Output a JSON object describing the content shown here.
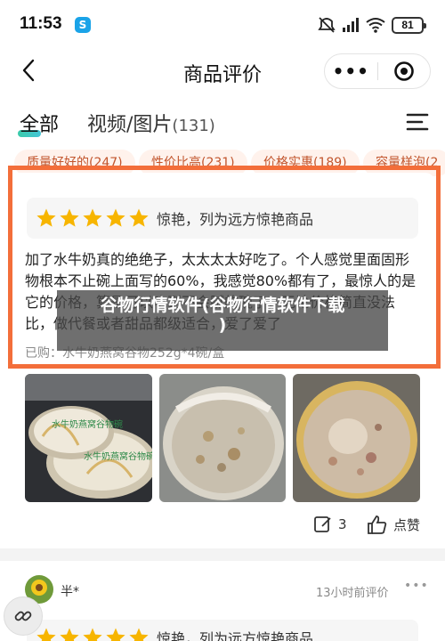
{
  "status_bar": {
    "time": "11:53",
    "app_badge": "S",
    "battery": "81"
  },
  "header": {
    "title": "商品评价",
    "more_label": "•••"
  },
  "tabs": {
    "all": "全部",
    "media": "视频/图片",
    "media_count": "(131)"
  },
  "chips": [
    "质量好好的(247)",
    "性价比高(231)",
    "价格实惠(189)",
    "容量样泡(2"
  ],
  "review1": {
    "rating_label": "惊艳，列为远方惊艳商品",
    "text": "加了水牛奶真的绝绝子，太太太太好吃了。个人感觉里面固形物根本不止碗上面写的60%，我感觉80%都有了，最惊人的是它的价格，算是可以吃到不会腻的碗了，无论价格简直没法比，做代餐或者甜品都级适合，爱了爱了",
    "purchased": "已购：水牛奶燕窝谷物252g*4碗/盒",
    "share_count": "3",
    "like_label": "点赞",
    "photo_label_1": "水牛奶燕窝谷物碗",
    "photo_label_2": "水牛奶燕窝谷物碗"
  },
  "overlay": {
    "line1": "谷物行情软件(谷物行情软件下载",
    "line2": ")"
  },
  "review2": {
    "user": "半*",
    "time": "13小时前评价",
    "more": "•••",
    "rating_label": "惊艳，列为远方惊艳商品"
  },
  "colors": {
    "highlight_frame": "#f36e3a",
    "star": "#f7b500",
    "chip_text": "#c2552d"
  }
}
